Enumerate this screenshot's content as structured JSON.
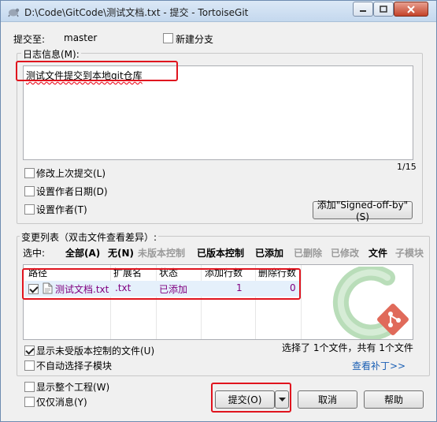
{
  "window": {
    "title": "D:\\Code\\GitCode\\测试文档.txt - 提交 - TortoiseGit"
  },
  "commit_to": {
    "label": "提交至:",
    "branch": "master",
    "new_branch_label": "新建分支",
    "new_branch_checked": false
  },
  "log": {
    "group_label": "日志信息(M):",
    "message": "测试文件提交到本地git仓库",
    "counter": "1/15",
    "options": [
      {
        "label": "修改上次提交(L)",
        "checked": false
      },
      {
        "label": "设置作者日期(D)",
        "checked": false
      },
      {
        "label": "设置作者(T)",
        "checked": false
      }
    ],
    "signed_off_button": "添加\"Signed-off-by\"(S)"
  },
  "changes": {
    "group_label": "变更列表（双击文件查看差异）:",
    "select_label": "选中:",
    "filters": [
      {
        "label": "全部(A)",
        "enabled": true
      },
      {
        "label": "无(N)",
        "enabled": true
      },
      {
        "label": "未版本控制",
        "enabled": false
      },
      {
        "label": "已版本控制",
        "enabled": true
      },
      {
        "label": "已添加",
        "enabled": true
      },
      {
        "label": "已删除",
        "enabled": false
      },
      {
        "label": "已修改",
        "enabled": false
      },
      {
        "label": "文件",
        "enabled": true
      },
      {
        "label": "子模块",
        "enabled": false
      }
    ],
    "columns": [
      "路径",
      "扩展名",
      "状态",
      "添加行数",
      "删除行数"
    ],
    "rows": [
      {
        "checked": true,
        "path": "测试文档.txt",
        "ext": ".txt",
        "status": "已添加",
        "added": "1",
        "deleted": "0"
      }
    ],
    "show_unversioned": {
      "label": "显示未受版本控制的文件(U)",
      "checked": true
    },
    "no_auto_submodule": {
      "label": "不自动选择子模块",
      "checked": false
    },
    "summary": "选择了 1个文件，共有 1个文件",
    "view_patch": "查看补丁>>"
  },
  "bottom": {
    "show_whole_project": {
      "label": "显示整个工程(W)",
      "checked": false
    },
    "message_only": {
      "label": "仅仅消息(Y)",
      "checked": false
    },
    "commit_button": "提交(O)",
    "cancel_button": "取消",
    "help_button": "帮助"
  },
  "colors": {
    "accent_red": "#e0141e",
    "added_purple": "#800080",
    "link_blue": "#1a5fb4",
    "logo_green": "#2e9e3e"
  }
}
